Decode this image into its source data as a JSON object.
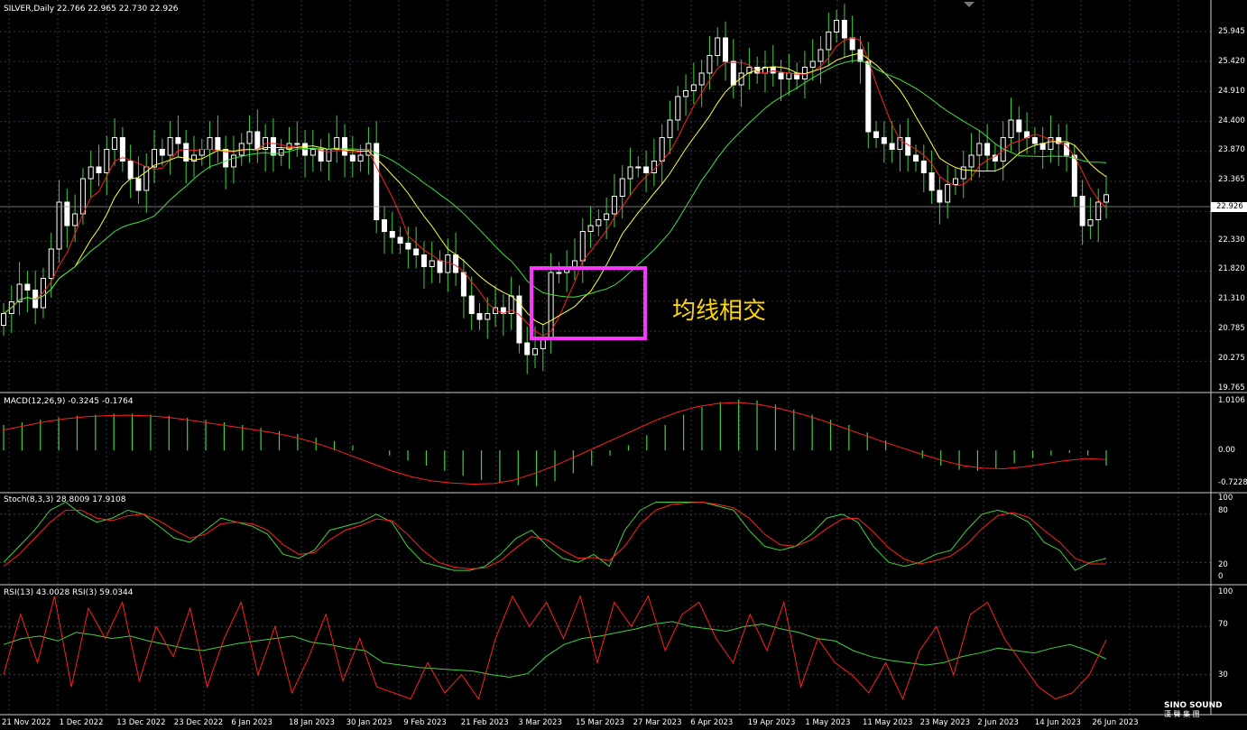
{
  "symbol_header": "SILVER,Daily  22.766 22.965 22.730 22.926",
  "macd_header": "MACD(12,26,9) -0.3245 -0.1764",
  "stoch_header": "Stoch(8,3,3) 28.8009 17.9108",
  "rsi_header": "RSI(13) 43.0028  RSI(3) 59.0344",
  "annotation": "均线相交",
  "current_price": "22.926",
  "price_axis": [
    "25.945",
    "25.420",
    "24.910",
    "24.400",
    "23.870",
    "23.365",
    "22.330",
    "21.820",
    "21.310",
    "20.785",
    "20.275",
    "19.765"
  ],
  "macd_axis": [
    "1.0106",
    "0.00",
    "-0.7228"
  ],
  "stoch_axis": [
    "100",
    "80",
    "20",
    "0"
  ],
  "rsi_axis": [
    "100",
    "70",
    "30"
  ],
  "date_axis": [
    "21 Nov 2022",
    "1 Dec 2022",
    "13 Dec 2022",
    "23 Dec 2022",
    "6 Jan 2023",
    "18 Jan 2023",
    "30 Jan 2023",
    "9 Feb 2023",
    "21 Feb 2023",
    "3 Mar 2023",
    "15 Mar 2023",
    "27 Mar 2023",
    "6 Apr 2023",
    "19 Apr 2023",
    "1 May 2023",
    "11 May 2023",
    "23 May 2023",
    "2 Jun 2023",
    "14 Jun 2023",
    "26 Jun 2023"
  ],
  "logo": {
    "line1": "SINO SOUND",
    "line2": "漢 聲 集 團"
  },
  "colors": {
    "candle": "#ffffff",
    "ma_fast": "#ff2020",
    "ma_mid": "#ffff40",
    "ma_slow": "#40e040",
    "macd_hist": "#40d040",
    "macd_signal": "#ff2020",
    "box": "#ff33ff",
    "grid": "#333344"
  },
  "chart_data": {
    "type": "line",
    "price_closes": [
      20.9,
      21.1,
      21.4,
      21.3,
      21.0,
      21.5,
      22.0,
      22.8,
      22.4,
      22.6,
      23.2,
      23.4,
      23.3,
      23.7,
      23.9,
      23.5,
      23.2,
      23.0,
      23.4,
      23.7,
      23.6,
      23.9,
      23.8,
      23.5,
      23.6,
      23.7,
      23.9,
      23.7,
      23.4,
      23.6,
      23.8,
      24.0,
      23.7,
      23.9,
      23.6,
      23.7,
      23.8,
      23.8,
      23.6,
      23.7,
      23.5,
      23.7,
      23.9,
      23.6,
      23.5,
      23.6,
      23.8,
      22.5,
      22.3,
      22.2,
      22.1,
      22.0,
      21.9,
      21.7,
      21.8,
      21.6,
      21.9,
      21.6,
      21.2,
      20.9,
      20.8,
      20.9,
      21.0,
      20.9,
      21.2,
      20.4,
      20.2,
      20.3,
      20.5,
      21.6,
      21.6,
      21.7,
      21.8,
      22.3,
      22.4,
      22.5,
      22.6,
      22.9,
      23.2,
      23.4,
      23.4,
      23.3,
      23.5,
      23.9,
      24.2,
      24.6,
      24.7,
      24.8,
      25.0,
      25.3,
      25.6,
      25.2,
      24.8,
      25.0,
      25.1,
      25.0,
      25.1,
      25.0,
      24.9,
      25.0,
      24.9,
      25.1,
      25.2,
      25.4,
      25.7,
      25.9,
      25.6,
      25.4,
      25.2,
      24.0,
      23.9,
      23.8,
      23.7,
      23.9,
      23.6,
      23.5,
      23.3,
      23.0,
      22.8,
      23.1,
      23.2,
      23.4,
      23.6,
      23.8,
      23.6,
      23.5,
      23.9,
      24.2,
      24.0,
      23.9,
      23.8,
      23.7,
      23.9,
      23.8,
      23.6,
      22.9,
      22.4,
      22.5,
      22.8,
      22.926
    ],
    "macd_hist": [
      0.5,
      0.55,
      0.6,
      0.65,
      0.68,
      0.7,
      0.72,
      0.72,
      0.7,
      0.68,
      0.64,
      0.6,
      0.55,
      0.5,
      0.44,
      0.38,
      0.32,
      0.25,
      0.18,
      0.1,
      0.0,
      -0.1,
      -0.2,
      -0.3,
      -0.4,
      -0.5,
      -0.58,
      -0.64,
      -0.68,
      -0.7,
      -0.6,
      -0.45,
      -0.3,
      -0.1,
      0.1,
      0.3,
      0.5,
      0.7,
      0.85,
      0.95,
      1.0,
      0.98,
      0.9,
      0.8,
      0.7,
      0.6,
      0.5,
      0.35,
      0.2,
      0.0,
      -0.15,
      -0.3,
      -0.38,
      -0.4,
      -0.35,
      -0.25,
      -0.15,
      -0.1,
      -0.05,
      -0.1,
      -0.3
    ],
    "macd_signal": [
      0.4,
      0.48,
      0.56,
      0.62,
      0.66,
      0.68,
      0.69,
      0.68,
      0.65,
      0.6,
      0.54,
      0.48,
      0.42,
      0.36,
      0.28,
      0.18,
      0.05,
      -0.1,
      -0.25,
      -0.4,
      -0.52,
      -0.6,
      -0.64,
      -0.66,
      -0.65,
      -0.58,
      -0.45,
      -0.3,
      -0.12,
      0.06,
      0.24,
      0.42,
      0.6,
      0.75,
      0.86,
      0.92,
      0.94,
      0.9,
      0.82,
      0.72,
      0.6,
      0.46,
      0.32,
      0.18,
      0.05,
      -0.08,
      -0.2,
      -0.3,
      -0.35,
      -0.36,
      -0.32,
      -0.26,
      -0.2,
      -0.16,
      -0.18
    ],
    "stoch_k": [
      20,
      40,
      60,
      85,
      95,
      80,
      70,
      75,
      85,
      80,
      65,
      50,
      45,
      60,
      75,
      70,
      65,
      55,
      30,
      25,
      35,
      60,
      65,
      70,
      80,
      70,
      40,
      20,
      15,
      10,
      10,
      15,
      30,
      50,
      60,
      40,
      25,
      20,
      30,
      15,
      60,
      85,
      95,
      95,
      95,
      95,
      90,
      85,
      60,
      40,
      35,
      40,
      55,
      75,
      80,
      70,
      40,
      20,
      15,
      20,
      30,
      35,
      60,
      80,
      85,
      80,
      70,
      45,
      35,
      10,
      20,
      25
    ],
    "stoch_d": [
      15,
      30,
      50,
      70,
      85,
      85,
      75,
      72,
      78,
      80,
      72,
      60,
      50,
      55,
      68,
      70,
      68,
      60,
      42,
      30,
      32,
      48,
      60,
      66,
      74,
      72,
      55,
      35,
      20,
      14,
      12,
      13,
      22,
      38,
      52,
      48,
      35,
      25,
      26,
      22,
      40,
      68,
      85,
      92,
      94,
      95,
      92,
      88,
      75,
      55,
      42,
      40,
      48,
      62,
      74,
      75,
      58,
      38,
      24,
      18,
      22,
      28,
      42,
      62,
      78,
      82,
      76,
      60,
      45,
      25,
      18,
      18
    ],
    "rsi_13": [
      55,
      60,
      62,
      58,
      65,
      63,
      60,
      62,
      58,
      55,
      52,
      50,
      53,
      56,
      58,
      60,
      62,
      57,
      55,
      52,
      50,
      40,
      38,
      36,
      35,
      34,
      33,
      30,
      28,
      31,
      45,
      55,
      60,
      62,
      65,
      68,
      72,
      74,
      70,
      68,
      66,
      70,
      72,
      68,
      65,
      60,
      58,
      50,
      45,
      42,
      40,
      38,
      40,
      45,
      48,
      52,
      50,
      48,
      52,
      55,
      50,
      43
    ],
    "rsi_3": [
      30,
      80,
      40,
      95,
      20,
      85,
      60,
      90,
      25,
      70,
      45,
      85,
      20,
      60,
      90,
      30,
      70,
      15,
      45,
      80,
      25,
      60,
      20,
      15,
      10,
      40,
      15,
      30,
      10,
      60,
      95,
      70,
      90,
      60,
      95,
      40,
      90,
      70,
      95,
      50,
      80,
      90,
      60,
      40,
      80,
      50,
      90,
      20,
      60,
      40,
      30,
      15,
      40,
      10,
      50,
      70,
      30,
      80,
      90,
      60,
      40,
      20,
      10,
      15,
      30,
      59
    ]
  }
}
